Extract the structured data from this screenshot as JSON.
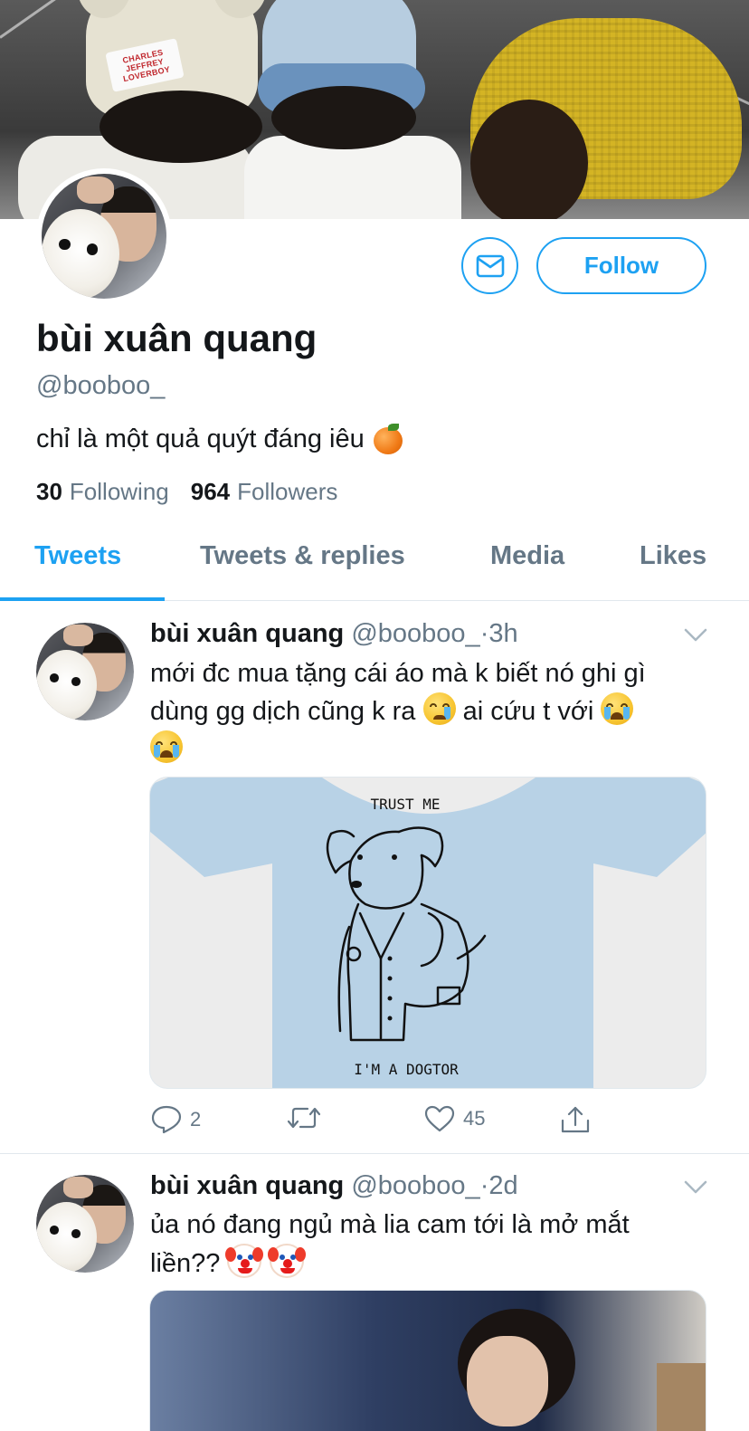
{
  "profile": {
    "display_name": "bùi xuân quang",
    "handle": "@booboo_",
    "bio": "chỉ là một quả quýt đáng iêu",
    "following_count": "30",
    "following_label": "Following",
    "followers_count": "964",
    "followers_label": "Followers",
    "follow_label": "Follow",
    "banner_label_text": "CHARLES JEFFREY LOVERBOY"
  },
  "tabs": [
    {
      "label": "Tweets",
      "active": true
    },
    {
      "label": "Tweets & replies",
      "active": false
    },
    {
      "label": "Media",
      "active": false
    },
    {
      "label": "Likes",
      "active": false
    }
  ],
  "tweets": [
    {
      "name": "bùi xuân quang",
      "handle": "@booboo_",
      "separator": "·",
      "time": "3h",
      "text_line1": "mới đc mua tặng cái áo mà k biết nó ghi gì",
      "text_line2a": "dùng gg dịch cũng k ra",
      "text_line2b": "ai cứu t với",
      "image_top_text": "TRUST ME",
      "image_bottom_text": "I'M A DOGTOR",
      "replies": "2",
      "retweets": "",
      "likes": "45"
    },
    {
      "name": "bùi xuân quang",
      "handle": "@booboo_",
      "separator": "·",
      "time": "2d",
      "text_line1": "ủa nó đang ngủ mà lia cam tới là mở mắt",
      "text_line2": "liền??"
    }
  ],
  "colors": {
    "accent": "#1da1f2",
    "secondary_text": "#657786",
    "primary_text": "#14171a",
    "divider": "#e1e8ed"
  },
  "icons": [
    "mail-icon",
    "chevron-down-icon",
    "reply-icon",
    "retweet-icon",
    "like-icon",
    "share-icon"
  ]
}
